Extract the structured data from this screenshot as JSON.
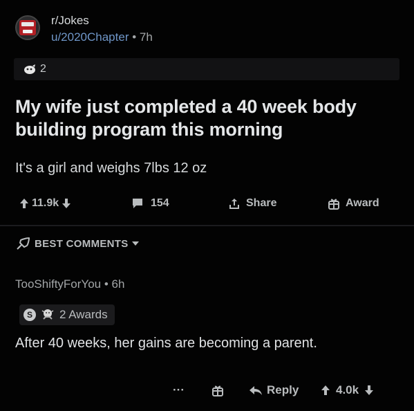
{
  "post": {
    "subreddit": "r/Jokes",
    "author": "u/2020Chapter",
    "separator": "•",
    "age": "7h",
    "awards_count": "2",
    "title": "My wife just completed a 40 week body building program this morning",
    "body": "It's a girl and weighs 7lbs 12 oz",
    "actions": {
      "upvotes": "11.9k",
      "comments": "154",
      "share": "Share",
      "award": "Award"
    }
  },
  "sort": {
    "label": "BEST COMMENTS"
  },
  "comment": {
    "author": "TooShiftyForYou",
    "separator": "•",
    "age": "6h",
    "awards_label": "2 Awards",
    "silver_glyph": "S",
    "body": "After 40 weeks, her gains are becoming a parent.",
    "actions": {
      "more": "···",
      "reply": "Reply",
      "votes": "4.0k"
    }
  },
  "colors": {
    "background": "#030303",
    "username": "#6f96c8",
    "text": "#d7dadc",
    "muted": "#a3a6a8"
  }
}
